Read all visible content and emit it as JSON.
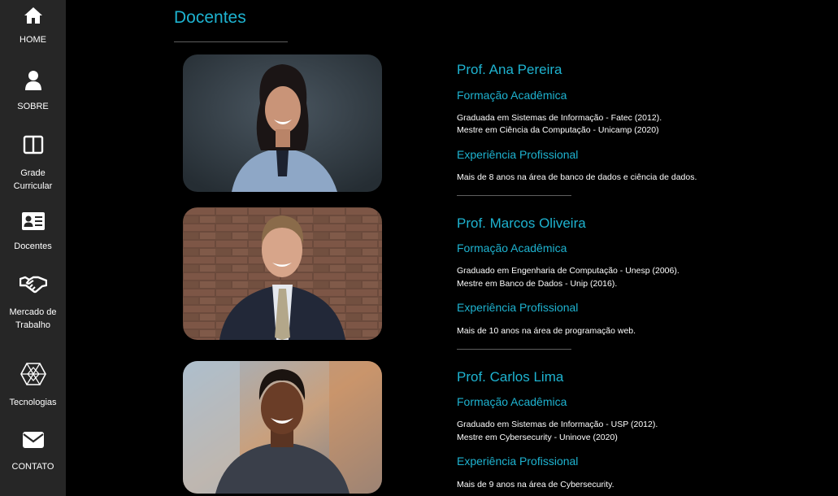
{
  "sidebar": {
    "items": [
      {
        "label": "HOME",
        "icon": "home-icon"
      },
      {
        "label": "SOBRE",
        "icon": "user-icon"
      },
      {
        "label": "Grade Curricular",
        "icon": "book-icon"
      },
      {
        "label": "Docentes",
        "icon": "id-card-icon"
      },
      {
        "label": "Mercado de Trabalho",
        "icon": "handshake-icon"
      },
      {
        "label": "Tecnologias",
        "icon": "hexagon-icon"
      },
      {
        "label": "CONTATO",
        "icon": "envelope-icon"
      }
    ]
  },
  "page": {
    "title": "Docentes"
  },
  "colors": {
    "accent": "#1eb3d0",
    "sidebar_bg": "#262626",
    "page_bg": "#000000"
  },
  "teachers": [
    {
      "name": "Prof. Ana Pereira",
      "education_heading": "Formação Acadêmica",
      "education": [
        "Graduada em Sistemas de Informação - Fatec (2012).",
        "Mestre em Ciência da Computação - Unicamp (2020)"
      ],
      "experience_heading": "Experiência Profissional",
      "experience": "Mais de 8 anos na área de banco de dados e ciência de dados."
    },
    {
      "name": "Prof. Marcos Oliveira",
      "education_heading": "Formação Acadêmica",
      "education": [
        "Graduado em Engenharia de Computação - Unesp (2006).",
        "Mestre em Banco de Dados - Unip (2016)."
      ],
      "experience_heading": "Experiência Profissional",
      "experience": "Mais de 10 anos na área de programação web."
    },
    {
      "name": "Prof. Carlos Lima",
      "education_heading": "Formação Acadêmica",
      "education": [
        "Graduado em Sistemas de Informação - USP (2012).",
        "Mestre em Cybersecurity - Uninove (2020)"
      ],
      "experience_heading": "Experiência Profissional",
      "experience": "Mais de 9 anos na área de Cybersecurity."
    }
  ]
}
